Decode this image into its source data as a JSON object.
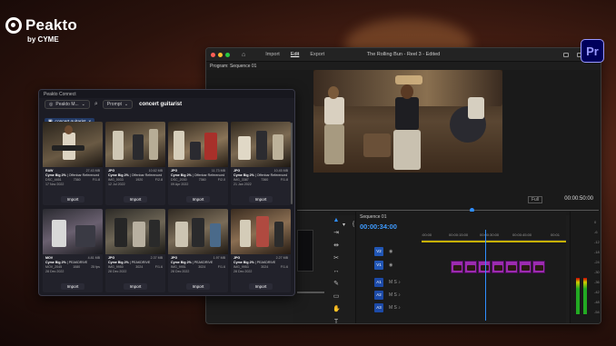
{
  "brand": {
    "name": "Peakto",
    "sub": "by CYME"
  },
  "premiere": {
    "menu": [
      "Import",
      "Edit",
      "Export"
    ],
    "active_menu": "Edit",
    "title": "The Rolling Bun - Reel 3 - Edited",
    "app_badge": "Pr",
    "monitor_label": "Program: Sequence 01",
    "fit": "Full",
    "monitor_timecode": "00:00:50:00",
    "sequence_tab": "Sequence 01",
    "sequence_timecode": "00:00:34:00",
    "ruler": [
      ":00:00",
      "00:00:15:00",
      "00:00:30:00",
      "00:00:45:00",
      "00:01"
    ],
    "tracks": [
      "V2",
      "V1",
      "A1",
      "A2",
      "A3"
    ],
    "meter_scale": [
      "0",
      "-6",
      "-12",
      "-18",
      "-24",
      "-30",
      "-36",
      "-42",
      "-48",
      "-54"
    ]
  },
  "peakto": {
    "title": "Peakto Connect",
    "source": "Peakto M...",
    "mode": "Prompt",
    "query": "concert guitarist",
    "tag": "concert guitarist",
    "import_label": "Import",
    "cards": [
      {
        "type": "RAW",
        "size": "27.43 MB",
        "name": "Cyme Big 2%",
        "ref": "Offenbar Referenced",
        "id": "DSC_4451",
        "res": "7360",
        "iso": "F/1.8",
        "date": "17 Nov 2022"
      },
      {
        "type": "JPG",
        "size": "10.62 MB",
        "name": "Cyme Big 2%",
        "ref": "Offenbar Referenced",
        "id": "IMG_0033",
        "res": "1920",
        "iso": "F/2.8",
        "date": "12 Jul 2022"
      },
      {
        "type": "JPG",
        "size": "11.73 MB",
        "name": "Cyme Big 2%",
        "ref": "Offenbar Referenced",
        "id": "DSC_2030",
        "res": "7360",
        "iso": "F/2.0",
        "date": "09 Apr 2022"
      },
      {
        "type": "JPG",
        "size": "10.45 MB",
        "name": "Cyme Big 2%",
        "ref": "Offenbar Referenced",
        "id": "IMG_3387",
        "res": "7360",
        "iso": "F/1.8",
        "date": "21 Jan 2022"
      },
      {
        "type": "MOV",
        "size": "4.81 MB",
        "name": "Cyme Big 2%",
        "ref": "PEAKDRIVE",
        "id": "MOV_2045",
        "res": "1080",
        "iso": "25 fps",
        "date": "28 Dec 2022"
      },
      {
        "type": "JPG",
        "size": "2.37 MB",
        "name": "Cyme Big 2%",
        "ref": "PEAKDRIVE",
        "id": "IMG_9950",
        "res": "3024",
        "iso": "F/1.6",
        "date": "28 Dec 2022"
      },
      {
        "type": "JPG",
        "size": "1.97 MB",
        "name": "Cyme Big 2%",
        "ref": "PEAKDRIVE",
        "id": "IMG_9951",
        "res": "3024",
        "iso": "F/1.6",
        "date": "28 Dec 2022"
      },
      {
        "type": "JPG",
        "size": "2.27 MB",
        "name": "Cyme Big 2%",
        "ref": "PEAKDRIVE",
        "id": "IMG_9953",
        "res": "3024",
        "iso": "F/1.6",
        "date": "28 Dec 2022"
      }
    ]
  },
  "colors": {
    "accent": "#2f8fff",
    "clip": "#9c2bb0",
    "premiere_badge": "#9999ff"
  }
}
